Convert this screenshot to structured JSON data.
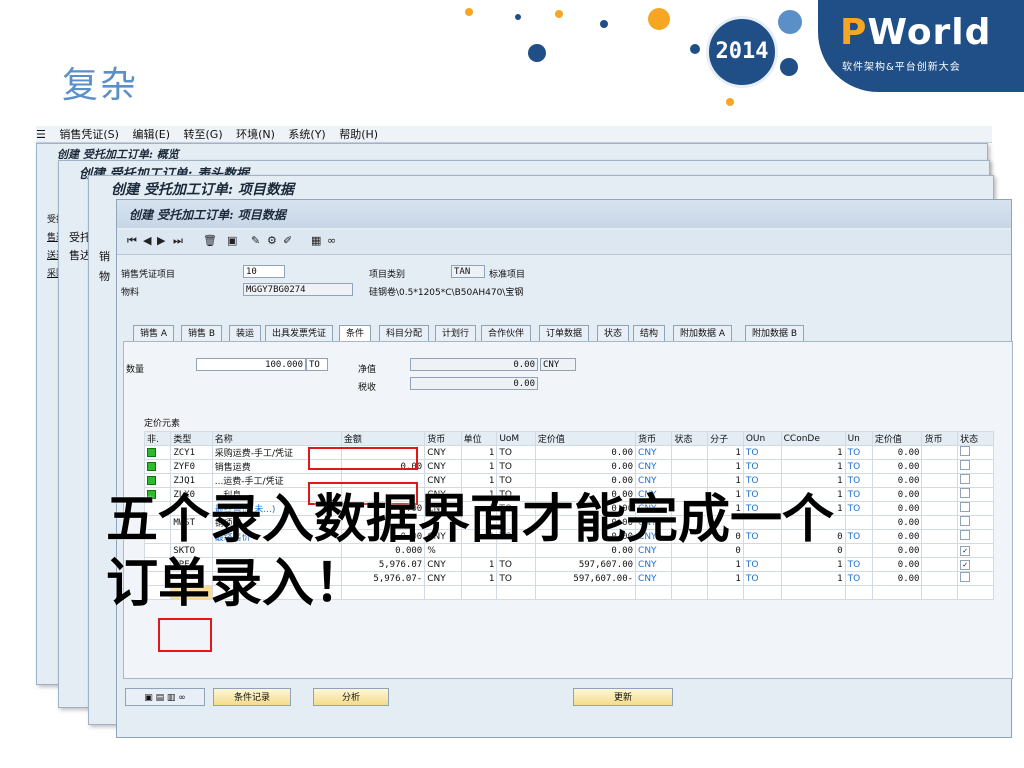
{
  "slide": {
    "title": "复杂",
    "year": "2014",
    "logo_p": "P",
    "logo_rest": "World",
    "logo_sub": "软件架构&平台创新大会"
  },
  "menu": [
    "销售凭证(S)",
    "编辑(E)",
    "转至(G)",
    "环境(N)",
    "系统(Y)",
    "帮助(H)"
  ],
  "windows": {
    "w1_title": "创建 受托加工订单: 概览",
    "w2_title": "创建 受托加工订单: 表头数据",
    "w3_title": "创建 受托加工订单: 项目数据",
    "w4_title": "创建 受托加工订单: 项目数据",
    "left_labels": [
      "受托",
      "售达",
      "送达",
      "采购"
    ],
    "w2_labels": [
      "受托",
      "售达"
    ],
    "w3_labels": [
      "销",
      "物"
    ]
  },
  "header_fields": {
    "item_label": "销售凭证项目",
    "item_value": "10",
    "material_label": "物料",
    "material_value": "MGGY7BG0274",
    "item_cat_label": "项目类别",
    "item_cat_value": "TAN",
    "item_cat_desc": "标准项目",
    "material_desc": "硅钢卷\\0.5*1205*C\\B50AH470\\宝钢"
  },
  "tabs": [
    "销售 A",
    "销售 B",
    "装运",
    "出具发票凭证",
    "条件",
    "科目分配",
    "计划行",
    "合作伙伴",
    "订单数据",
    "状态",
    "结构",
    "附加数据 A",
    "附加数据 B"
  ],
  "active_tab": "条件",
  "condition_header": {
    "qty_label": "数量",
    "qty_value": "100.000",
    "qty_unit": "TO",
    "net_label": "净值",
    "net_value": "0.00",
    "net_currency": "CNY",
    "tax_label": "税收",
    "tax_value": "0.00"
  },
  "pricing": {
    "section_label": "定价元素",
    "columns": [
      "非.",
      "类型",
      "名称",
      "金额",
      "货币",
      "单位",
      "UoM",
      "定价值",
      "货币",
      "状态",
      "分子",
      "OUn",
      "CConDe",
      "Un",
      "定价值",
      "货币",
      "状态"
    ],
    "rows": [
      {
        "type": "ZCY1",
        "name": "采购运费-手工/凭证",
        "amount": "",
        "cur": "CNY",
        "per": "1",
        "uom": "TO",
        "cond_value": "0.00",
        "cur2": "CNY",
        "num": "1",
        "oun": "TO",
        "ccon": "1",
        "un": "TO",
        "val2": "0.00",
        "ind": true
      },
      {
        "type": "ZYF0",
        "name": "销售运费",
        "amount": "0.00",
        "cur": "CNY",
        "per": "1",
        "uom": "TO",
        "cond_value": "0.00",
        "cur2": "CNY",
        "num": "1",
        "oun": "TO",
        "ccon": "1",
        "un": "TO",
        "val2": "0.00",
        "ind": true
      },
      {
        "type": "ZJQ1",
        "name": "...运费-手工/凭证",
        "amount": "",
        "cur": "CNY",
        "per": "1",
        "uom": "TO",
        "cond_value": "0.00",
        "cur2": "CNY",
        "num": "1",
        "oun": "TO",
        "ccon": "1",
        "un": "TO",
        "val2": "0.00",
        "ind": true
      },
      {
        "type": "ZLX0",
        "name": "...利息",
        "amount": "",
        "cur": "CNY",
        "per": "1",
        "uom": "TO",
        "cond_value": "0.00",
        "cur2": "CNY",
        "num": "1",
        "oun": "TO",
        "ccon": "1",
        "un": "TO",
        "val2": "0.00",
        "ind": true
      },
      {
        "type": "",
        "name": "最终售价(未...)",
        "amount": "0.00",
        "cur": "CNY",
        "per": "1",
        "uom": "TO",
        "cond_value": "0.00",
        "cur2": "CNY",
        "num": "1",
        "oun": "TO",
        "ccon": "1",
        "un": "TO",
        "val2": "0.00",
        "ind": false
      },
      {
        "type": "MWST",
        "name": "销项税",
        "amount": "",
        "cur": "",
        "per": "",
        "uom": "",
        "cond_value": "0.00",
        "cur2": "CNY",
        "num": "",
        "oun": "",
        "ccon": "",
        "un": "",
        "val2": "0.00",
        "ind": false
      },
      {
        "type": "",
        "name": "最终售价",
        "amount": "0.00",
        "cur": "CNY",
        "per": "1",
        "uom": "TO",
        "cond_value": "0.00",
        "cur2": "CNY",
        "num": "0",
        "oun": "TO",
        "ccon": "0",
        "un": "TO",
        "val2": "0.00",
        "ind": false
      },
      {
        "type": "SKTO",
        "name": "",
        "amount": "0.000",
        "cur": "%",
        "per": "",
        "uom": "",
        "cond_value": "0.00",
        "cur2": "CNY",
        "num": "0",
        "oun": "",
        "ccon": "0",
        "un": "",
        "val2": "0.00",
        "ind": false,
        "checked": true
      },
      {
        "type": "ZPF",
        "name": "",
        "amount": "5,976.07",
        "cur": "CNY",
        "per": "1",
        "uom": "TO",
        "cond_value": "597,607.00",
        "cur2": "CNY",
        "num": "1",
        "oun": "TO",
        "ccon": "1",
        "un": "TO",
        "val2": "0.00",
        "ind": false,
        "checked": true
      },
      {
        "type": "",
        "name": "",
        "amount": "5,976.07-",
        "cur": "CNY",
        "per": "1",
        "uom": "TO",
        "cond_value": "597,607.00-",
        "cur2": "CNY",
        "num": "1",
        "oun": "TO",
        "ccon": "1",
        "un": "TO",
        "val2": "0.00",
        "ind": false
      }
    ]
  },
  "buttons": {
    "cond_record": "条件记录",
    "analysis": "分析",
    "update": "更新"
  },
  "overlay_text_line1": "五个录入数据界面才能完成一个",
  "overlay_text_line2": "订单录入！"
}
